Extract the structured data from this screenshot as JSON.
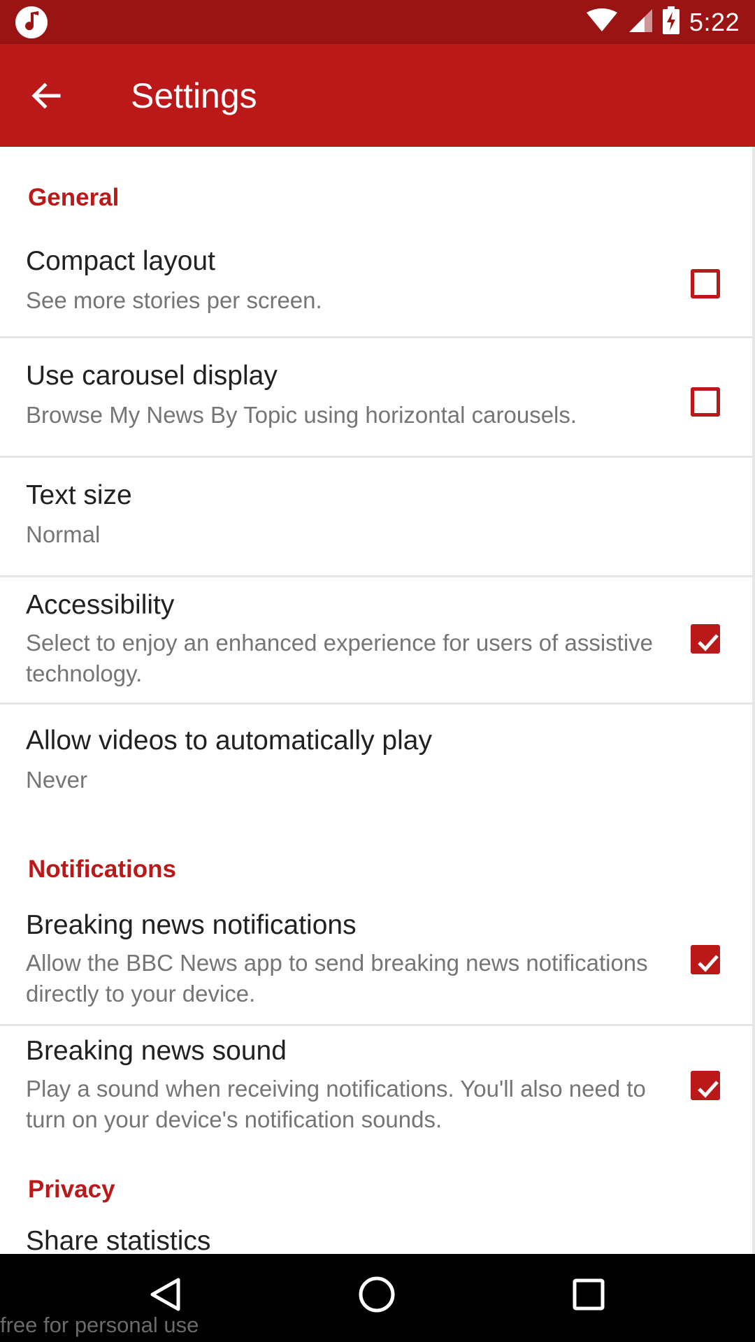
{
  "status_bar": {
    "time": "5:22",
    "app_icon": "music-note-icon",
    "wifi_icon": "wifi-icon",
    "signal_icon": "cell-signal-icon",
    "battery_icon": "battery-charging-icon"
  },
  "app_bar": {
    "title": "Settings",
    "back_icon": "back-arrow-icon",
    "color": "#bb1919"
  },
  "sections": {
    "general": "General",
    "notifications": "Notifications",
    "privacy": "Privacy"
  },
  "prefs": {
    "compact_layout": {
      "title": "Compact layout",
      "summary": "See more stories per screen.",
      "checked": false
    },
    "carousel": {
      "title": "Use carousel display",
      "summary": "Browse My News By Topic using horizontal carousels.",
      "checked": false
    },
    "text_size": {
      "title": "Text size",
      "summary": "Normal"
    },
    "accessibility": {
      "title": "Accessibility",
      "summary": "Select to enjoy an enhanced experience for users of assistive technology.",
      "checked": true
    },
    "autoplay": {
      "title": "Allow videos to automatically play",
      "summary": "Never"
    },
    "breaking_notifications": {
      "title": "Breaking news notifications",
      "summary": "Allow the BBC News app to send breaking news notifications directly to your device.",
      "checked": true
    },
    "breaking_sound": {
      "title": "Breaking news sound",
      "summary": "Play a sound when receiving notifications. You'll also need to turn on your device's notification sounds.",
      "checked": true
    },
    "share_statistics": {
      "title": "Share statistics"
    }
  },
  "nav_bar": {
    "back": "nav-back-icon",
    "home": "nav-home-icon",
    "recents": "nav-recents-icon"
  },
  "watermark": "free for personal use"
}
